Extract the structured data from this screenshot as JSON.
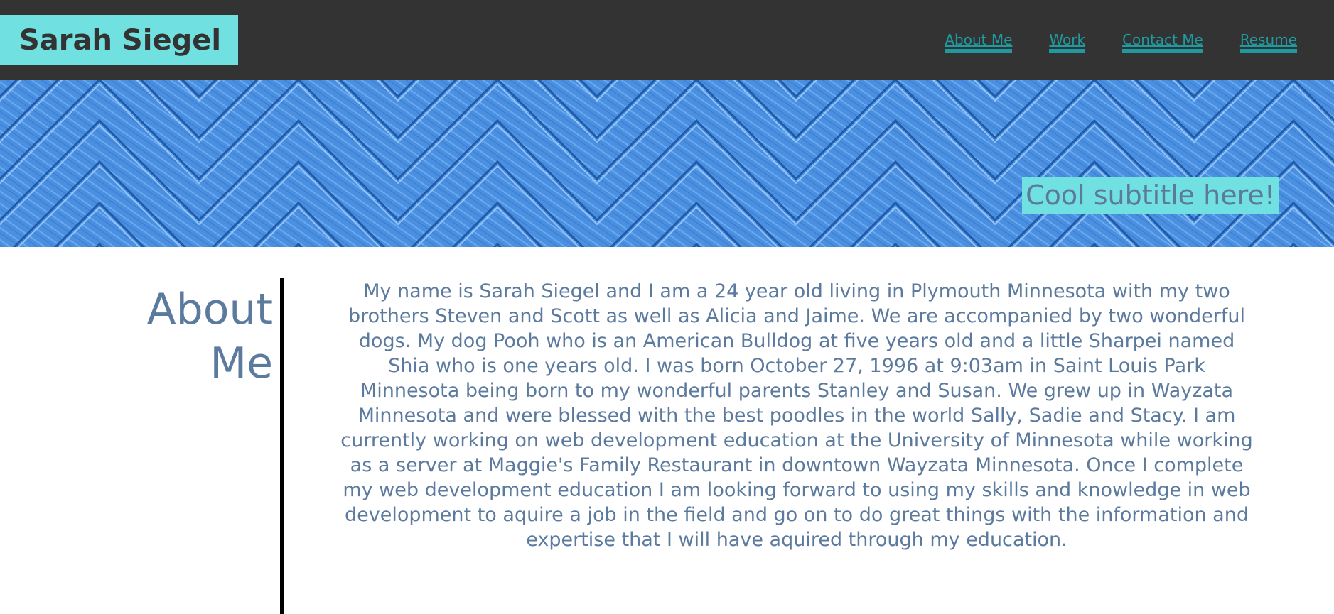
{
  "header": {
    "brand": "Sarah Siegel",
    "nav": [
      {
        "label": "About Me"
      },
      {
        "label": "Work"
      },
      {
        "label": "Contact Me"
      },
      {
        "label": "Resume"
      }
    ]
  },
  "hero": {
    "subtitle": "Cool subtitle here!"
  },
  "about": {
    "heading": "About Me",
    "body": "My name is Sarah Siegel and I am a 24 year old living in Plymouth Minnesota with my two brothers Steven and Scott as well as Alicia and Jaime. We are accompanied by two wonderful dogs. My dog Pooh who is an American Bulldog at five years old and a little Sharpei named Shia who is one years old. I was born October 27, 1996 at 9:03am in Saint Louis Park Minnesota being born to my wonderful parents Stanley and Susan. We grew up in Wayzata Minnesota and were blessed with the best poodles in the world Sally, Sadie and Stacy. I am currently working on web development education at the University of Minnesota while working as a server at Maggie's Family Restaurant in downtown Wayzata Minnesota. Once I complete my web development education I am looking forward to using my skills and knowledge in web development to aquire a job in the field and go on to do great things with the information and expertise that I will have aquired through my education."
  },
  "colors": {
    "header_bg": "#333333",
    "accent_cyan": "#71e0e1",
    "nav_link": "#1f9aa0",
    "text_slate": "#5b7a9e",
    "hero_blue": "#4a8fe0"
  }
}
